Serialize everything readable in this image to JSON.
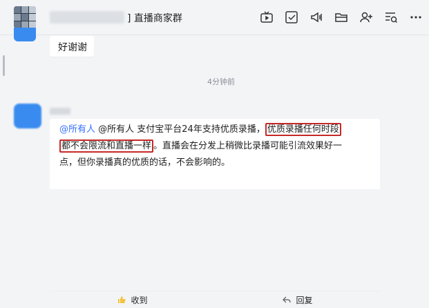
{
  "header": {
    "chat_title": "] 直播商家群",
    "toolbar_icons": [
      "live-icon",
      "task-check-icon",
      "announcement-icon",
      "folder-icon",
      "add-member-icon",
      "search-history-icon",
      "more-icon"
    ]
  },
  "messages": [
    {
      "text": "好谢谢"
    }
  ],
  "timestamp": "4分钟前",
  "message2": {
    "mention": "@所有人",
    "segment1": " @所有人   支付宝平台24年支持优质录播，",
    "highlight1": "优质录播任何时段",
    "highlight2": "都不会限流和直播一样",
    "segment2": "。直播会在分发上稍微比录播可能引流效果好一",
    "line3": "点，但你录播真的优质的话，不会影响的。",
    "acknowledge_label": "收到",
    "reply_label": "回复"
  },
  "colors": {
    "highlight_border": "#c62828",
    "mention": "#3370ff",
    "avatar_blue": "#3a8bf0"
  }
}
